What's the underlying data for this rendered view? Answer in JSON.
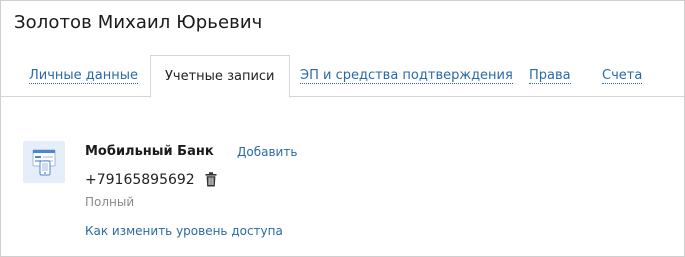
{
  "page_title": "Золотов Михаил Юрьевич",
  "tabs": [
    {
      "label": "Личные данные",
      "active": false
    },
    {
      "label": "Учетные записи",
      "active": true
    },
    {
      "label": "ЭП и средства подтверждения",
      "active": false
    },
    {
      "label": "Права",
      "active": false
    },
    {
      "label": "Счета",
      "active": false
    }
  ],
  "account": {
    "icon": "mobile-bank-icon",
    "product_name": "Мобильный Банк",
    "add_label": "Добавить",
    "phone": "+79165895692",
    "delete_icon": "trash-icon",
    "access_level": "Полный",
    "change_access_link": "Как изменить уровень доступа"
  },
  "colors": {
    "link": "#2a6aa8",
    "border": "#d6d6d6",
    "icon_bg": "#e6eef9",
    "icon_accent": "#4a86d6",
    "muted_text": "#8a8a8a"
  }
}
